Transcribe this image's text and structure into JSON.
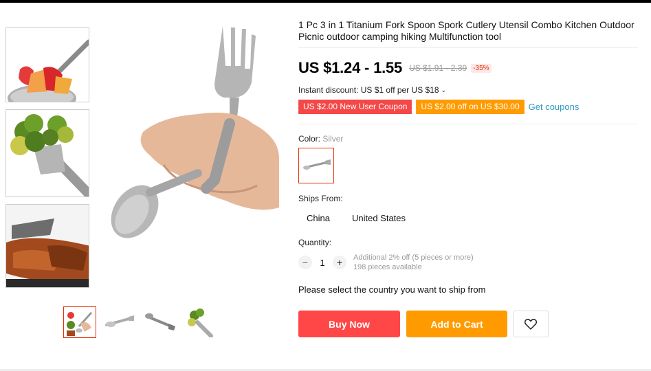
{
  "product": {
    "title": "1 Pc 3 in 1 Titanium Fork Spoon Spork Cutlery Utensil Combo Kitchen Outdoor Picnic outdoor camping hiking Multifunction tool",
    "price": "US $1.24 - 1.55",
    "original_price": "US $1.91 - 2.39",
    "discount": "-35%",
    "instant_discount": "Instant discount: US $1 off per US $18"
  },
  "coupons": {
    "items": [
      {
        "label": "US $2.00 New User Coupon",
        "color": "#f44848"
      },
      {
        "label": "US $2.00 off on US $30.00",
        "color": "#ff9b00"
      }
    ],
    "get_label": "Get coupons"
  },
  "color": {
    "label": "Color:",
    "selected": "Silver"
  },
  "ships_from": {
    "label": "Ships From:",
    "options": [
      "China",
      "United States"
    ]
  },
  "quantity": {
    "label": "Quantity:",
    "value": "1",
    "minus": "−",
    "plus": "+",
    "note": "Additional 2% off (5 pieces or more)",
    "available": "198 pieces available"
  },
  "select_country": "Please select the country you want to ship from",
  "actions": {
    "buy_now": "Buy Now",
    "add_to_cart": "Add to Cart",
    "wishlist_icon": "heart-icon"
  },
  "colors": {
    "accent_red": "#ff4747",
    "accent_orange": "#ff9b00",
    "link": "#2e9cc3"
  }
}
